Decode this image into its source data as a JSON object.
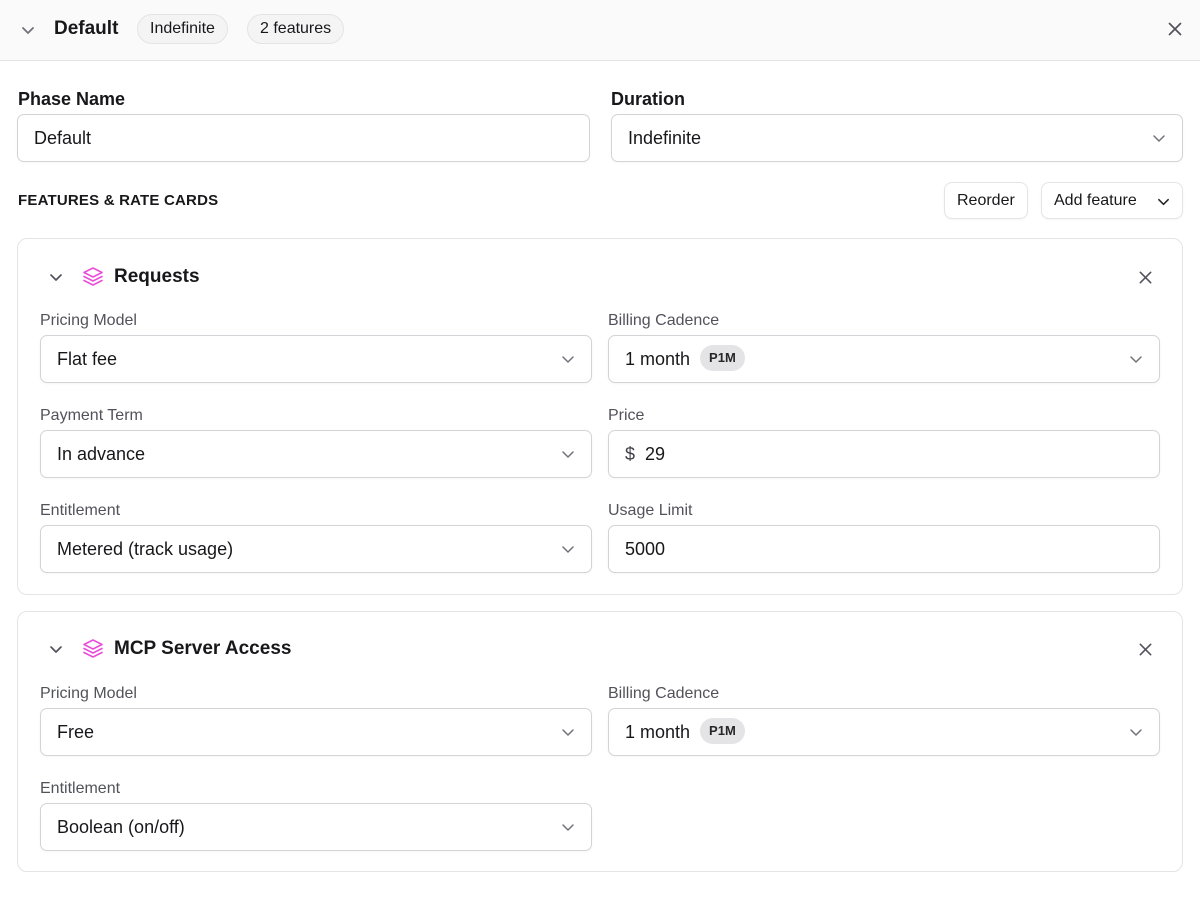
{
  "header": {
    "title": "Default",
    "duration_pill": "Indefinite",
    "features_pill": "2 features"
  },
  "phase": {
    "name_label": "Phase Name",
    "name_value": "Default",
    "duration_label": "Duration",
    "duration_value": "Indefinite"
  },
  "features_section": {
    "heading": "FEATURES & RATE CARDS",
    "reorder_label": "Reorder",
    "add_feature_label": "Add feature"
  },
  "features": [
    {
      "title": "Requests",
      "pricing_model_label": "Pricing Model",
      "pricing_model_value": "Flat fee",
      "billing_cadence_label": "Billing Cadence",
      "billing_cadence_value": "1 month",
      "billing_cadence_badge": "P1M",
      "payment_term_label": "Payment Term",
      "payment_term_value": "In advance",
      "price_label": "Price",
      "price_currency": "$",
      "price_value": "29",
      "entitlement_label": "Entitlement",
      "entitlement_value": "Metered (track usage)",
      "usage_limit_label": "Usage Limit",
      "usage_limit_value": "5000"
    },
    {
      "title": "MCP Server Access",
      "pricing_model_label": "Pricing Model",
      "pricing_model_value": "Free",
      "billing_cadence_label": "Billing Cadence",
      "billing_cadence_value": "1 month",
      "billing_cadence_badge": "P1M",
      "entitlement_label": "Entitlement",
      "entitlement_value": "Boolean (on/off)"
    }
  ],
  "colors": {
    "feature_icon": "#e84fd8",
    "border": "#e4e4e7",
    "header_bg": "#fafafa"
  },
  "icons": {
    "collapse": "chevron-down-icon",
    "close": "close-icon",
    "feature": "layers-icon",
    "select": "chevron-down-icon"
  }
}
